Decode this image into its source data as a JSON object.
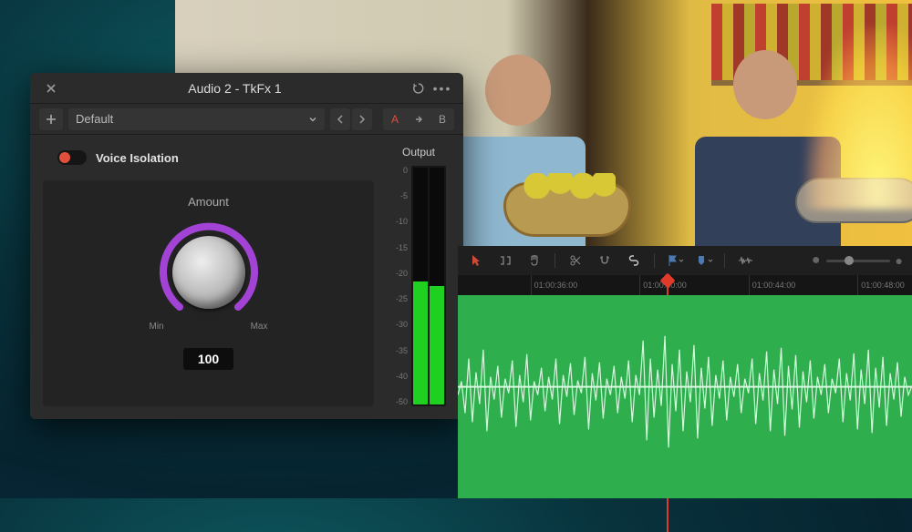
{
  "panel": {
    "title": "Audio 2 - TkFx 1",
    "preset": {
      "selected": "Default"
    },
    "ab": {
      "a": "A",
      "b": "B",
      "active": "A"
    },
    "effect": {
      "name": "Voice Isolation",
      "enabled": true,
      "param": {
        "label": "Amount",
        "value": "100",
        "min": "Min",
        "max": "Max"
      }
    },
    "output": {
      "label": "Output",
      "scale": [
        "0",
        "-5",
        "-10",
        "-15",
        "-20",
        "-25",
        "-30",
        "-35",
        "-40",
        "-50"
      ]
    }
  },
  "timeline": {
    "timecodes": [
      "01:00:36:00",
      "01:00:40:00",
      "01:00:44:00",
      "01:00:48:00"
    ],
    "playhead_pct": 46
  }
}
